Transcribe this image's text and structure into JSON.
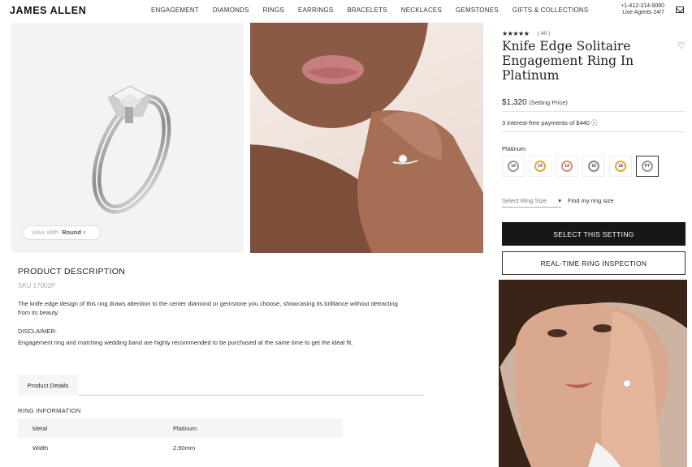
{
  "header": {
    "logo": "JAMES ALLEN",
    "nav": [
      "ENGAGEMENT",
      "DIAMONDS",
      "RINGS",
      "EARRINGS",
      "BRACELETS",
      "NECKLACES",
      "GEMSTONES",
      "GIFTS & COLLECTIONS"
    ],
    "phone": "+1-412-314-9060",
    "phone_sub": "Live Agents 24/7"
  },
  "gallery": {
    "view_with_label": "View With",
    "view_with_value": "Round"
  },
  "product": {
    "stars": "★★★★★",
    "review_count": "( 40 )",
    "title": "Knife Edge Solitaire Engagement Ring In Platinum",
    "price": "$1,320",
    "price_note": "(Setting Price)",
    "payments": "3 interest-free payments of $440 ⓘ",
    "metal_label": "Platinum",
    "metals": [
      {
        "label": "14",
        "color": "#9a9a9a"
      },
      {
        "label": "14",
        "color": "#e2a63b"
      },
      {
        "label": "14",
        "color": "#e08a78"
      },
      {
        "label": "18",
        "color": "#8a8a8a"
      },
      {
        "label": "18",
        "color": "#e2a63b"
      },
      {
        "label": "PT",
        "color": "#9a9a9a"
      }
    ],
    "size_select": "Select Ring Size",
    "find_size": "Find my ring size",
    "primary_button": "SELECT THIS SETTING",
    "secondary_button": "REAL-TIME RING INSPECTION"
  },
  "description": {
    "title": "PRODUCT DESCRIPTION",
    "sku": "SKU 17002P",
    "text": "The knife edge design of this ring draws attention to the center diamond or gemstone you choose, showcasing its brilliance without detracting from its beauty.",
    "disclaimer_label": "DISCLAIMER:",
    "disclaimer": "Engagement ring and matching wedding band are highly recommended to be purchased at the same time to get the ideal fit.",
    "tab": "Product Details",
    "ring_info_title": "RING INFORMATION",
    "rows": [
      {
        "key": "Metal",
        "value": "Platinum"
      },
      {
        "key": "Width",
        "value": "2.50mm"
      }
    ]
  }
}
